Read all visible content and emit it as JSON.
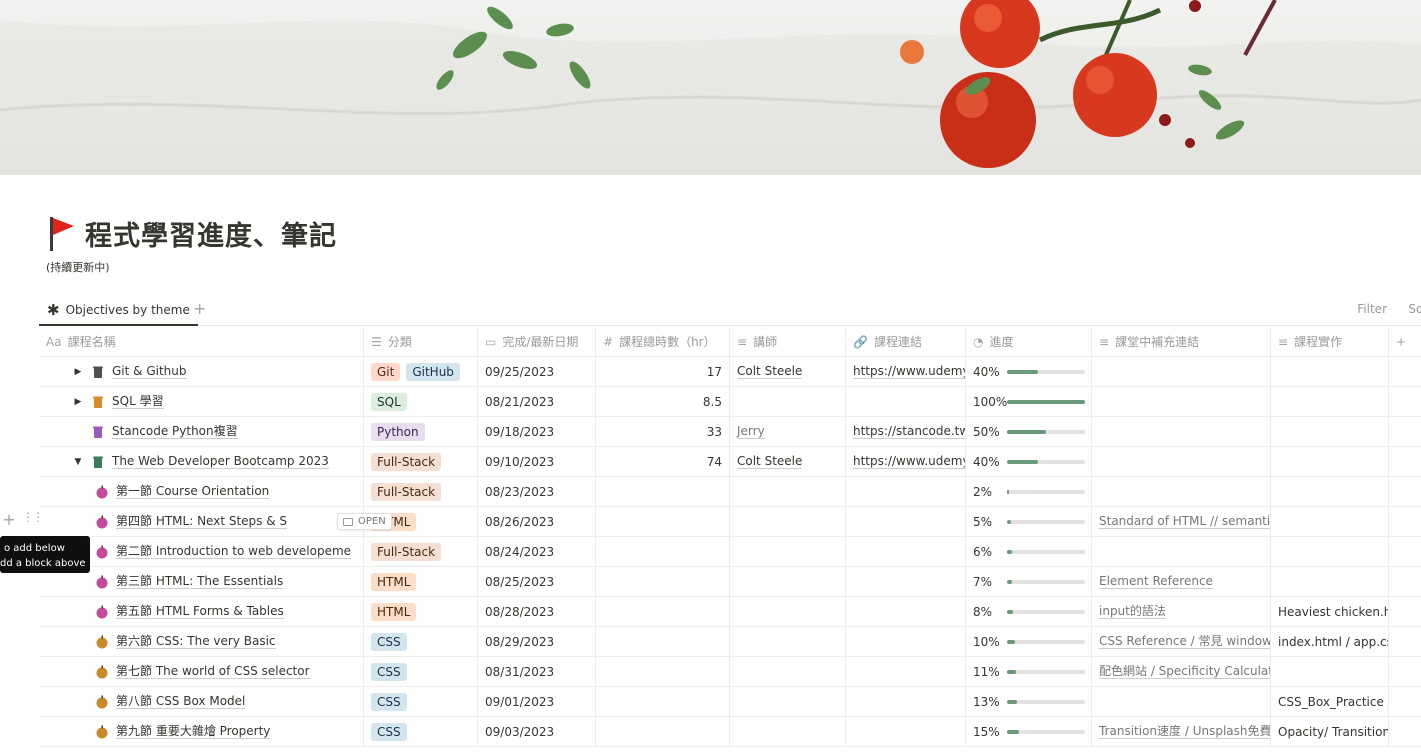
{
  "page": {
    "title": "程式學習進度、筆記",
    "subtitle": "(持續更新中)"
  },
  "view": {
    "tab_label": "Objectives by theme",
    "add_label": "+",
    "filter_label": "Filter",
    "sort_label": "Sort"
  },
  "columns": [
    "課程名稱",
    "分類",
    "完成/最新日期",
    "課程總時數（hr）",
    "講師",
    "課程連結",
    "進度",
    "課堂中補充連結",
    "課程實作",
    "+"
  ],
  "rows": [
    {
      "name": "Git & Github",
      "tags": [
        "Git",
        "GitHub"
      ],
      "date": "09/25/2023",
      "hours": "17",
      "teacher": "Colt Steele",
      "link": "https://www.udemy.",
      "pct": "40%",
      "progress": 40,
      "extra": "",
      "practice": "",
      "expand": "closed"
    },
    {
      "name": "SQL 學習",
      "tags": [
        "SQL"
      ],
      "date": "08/21/2023",
      "hours": "8.5",
      "teacher": "",
      "link": "",
      "pct": "100%",
      "progress": 100,
      "extra": "",
      "practice": "",
      "expand": "closed"
    },
    {
      "name": "Stancode Python複習",
      "tags": [
        "Python"
      ],
      "date": "09/18/2023",
      "hours": "33",
      "teacher": "Jerry",
      "link": "https://stancode.tw/",
      "pct": "50%",
      "progress": 50,
      "extra": "",
      "practice": "",
      "expand": "none"
    },
    {
      "name": "The Web Developer Bootcamp 2023",
      "tags": [
        "Full-Stack"
      ],
      "date": "09/10/2023",
      "hours": "74",
      "teacher": "Colt Steele",
      "link": "https://www.udemy.",
      "pct": "40%",
      "progress": 40,
      "extra": "",
      "practice": "",
      "expand": "open"
    },
    {
      "name": "第一節 Course Orientation",
      "tags": [
        "Full-Stack"
      ],
      "date": "08/23/2023",
      "hours": "",
      "teacher": "",
      "link": "",
      "pct": "2%",
      "progress": 2,
      "extra": "",
      "practice": ""
    },
    {
      "name": "第四節 HTML: Next Steps & S",
      "tags": [
        "HTML"
      ],
      "date": "08/26/2023",
      "hours": "",
      "teacher": "",
      "link": "",
      "pct": "5%",
      "progress": 5,
      "extra": "Standard of HTML // semantic",
      "practice": "",
      "open": "OPEN"
    },
    {
      "name": "第二節 Introduction to web developeme",
      "tags": [
        "Full-Stack"
      ],
      "date": "08/24/2023",
      "hours": "",
      "teacher": "",
      "link": "",
      "pct": "6%",
      "progress": 6,
      "extra": "",
      "practice": ""
    },
    {
      "name": "第三節 HTML: The Essentials",
      "tags": [
        "HTML"
      ],
      "date": "08/25/2023",
      "hours": "",
      "teacher": "",
      "link": "",
      "pct": "7%",
      "progress": 7,
      "extra": "Element Reference",
      "practice": ""
    },
    {
      "name": "第五節 HTML Forms & Tables",
      "tags": [
        "HTML"
      ],
      "date": "08/28/2023",
      "hours": "",
      "teacher": "",
      "link": "",
      "pct": "8%",
      "progress": 8,
      "extra": "input的語法",
      "practice": "Heaviest chicken.htr"
    },
    {
      "name": "第六節 CSS: The very Basic",
      "tags": [
        "CSS"
      ],
      "date": "08/29/2023",
      "hours": "",
      "teacher": "",
      "link": "",
      "pct": "10%",
      "progress": 10,
      "extra": "CSS Reference / 常見 window手",
      "practice": "index.html / app.css"
    },
    {
      "name": "第七節 The world of CSS selector",
      "tags": [
        "CSS"
      ],
      "date": "08/31/2023",
      "hours": "",
      "teacher": "",
      "link": "",
      "pct": "11%",
      "progress": 11,
      "extra": "配色網站 / Specificity Calculate",
      "practice": ""
    },
    {
      "name": "第八節 CSS Box Model",
      "tags": [
        "CSS"
      ],
      "date": "09/01/2023",
      "hours": "",
      "teacher": "",
      "link": "",
      "pct": "13%",
      "progress": 13,
      "extra": "",
      "practice": "CSS_Box_Practice / F"
    },
    {
      "name": "第九節 重要大雜燴 Property",
      "tags": [
        "CSS"
      ],
      "date": "09/03/2023",
      "hours": "",
      "teacher": "",
      "link": "",
      "pct": "15%",
      "progress": 15,
      "extra": "Transition速度 / Unsplash免費",
      "practice": "Opacity/ Transition/"
    }
  ],
  "tooltip": {
    "line1": "o add below",
    "line2": "dd a block above"
  },
  "colors": {
    "progress": "#6b9a7a",
    "text": "#37352f"
  }
}
